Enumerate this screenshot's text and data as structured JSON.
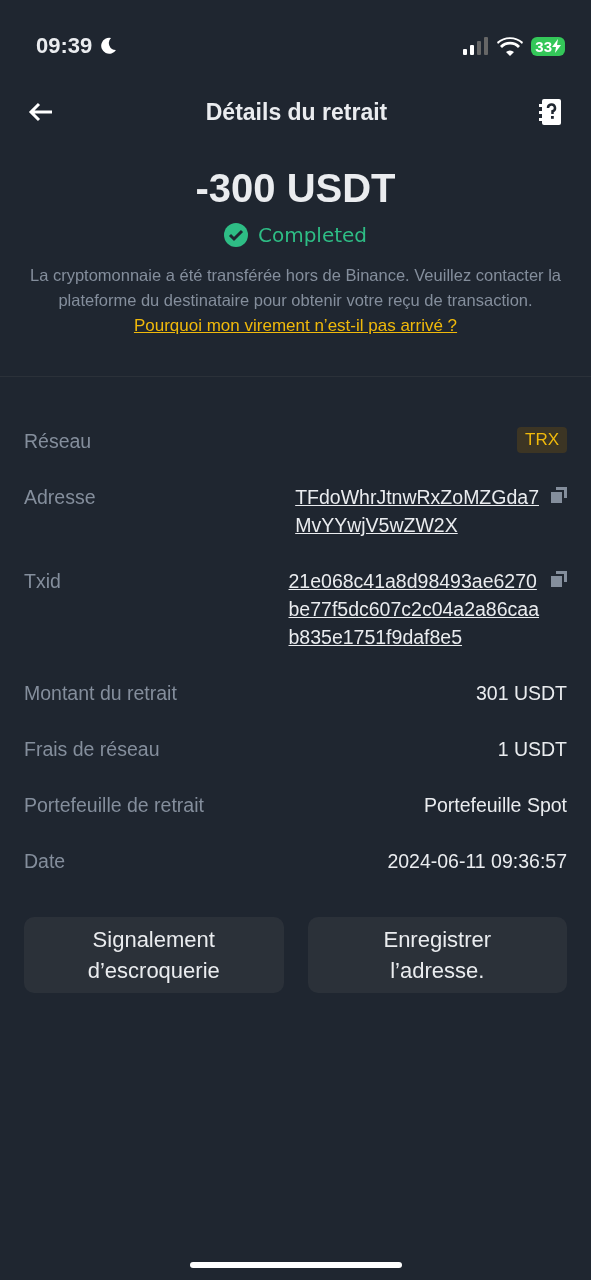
{
  "status_bar": {
    "time": "09:39",
    "battery": "33"
  },
  "header": {
    "title": "Détails du retrait"
  },
  "summary": {
    "amount": "-300 USDT",
    "status": "Completed",
    "message": "La cryptomonnaie a été transférée hors de Binance. Veuillez contacter la plateforme du destinataire pour obtenir votre reçu de transaction.",
    "help_link": "Pourquoi mon virement n’est-il pas arrivé ?"
  },
  "details": [
    {
      "kind": "badge",
      "label": "Réseau",
      "value_lines": [
        "TRX"
      ]
    },
    {
      "kind": "copy",
      "label": "Adresse",
      "value_lines": [
        "TFdoWhrJtnwRxZoMZGda7",
        "MvYYwjV5wZW2X"
      ]
    },
    {
      "kind": "copy",
      "label": "Txid",
      "value_lines": [
        "21e068c41a8d98493ae6270",
        "be77f5dc607c2c04a2a86caa",
        "b835e1751f9daf8e5"
      ]
    },
    {
      "kind": "text",
      "label": "Montant du retrait",
      "value_lines": [
        "301 USDT"
      ]
    },
    {
      "kind": "text",
      "label": "Frais de réseau",
      "value_lines": [
        "1 USDT"
      ]
    },
    {
      "kind": "text",
      "label": "Portefeuille de retrait",
      "value_lines": [
        "Portefeuille Spot"
      ]
    },
    {
      "kind": "text",
      "label": "Date",
      "value_lines": [
        "2024-06-11 09:36:57"
      ]
    }
  ],
  "buttons": [
    [
      "Signalement",
      "d’escroquerie"
    ],
    [
      "Enregistrer",
      "l’adresse."
    ]
  ]
}
